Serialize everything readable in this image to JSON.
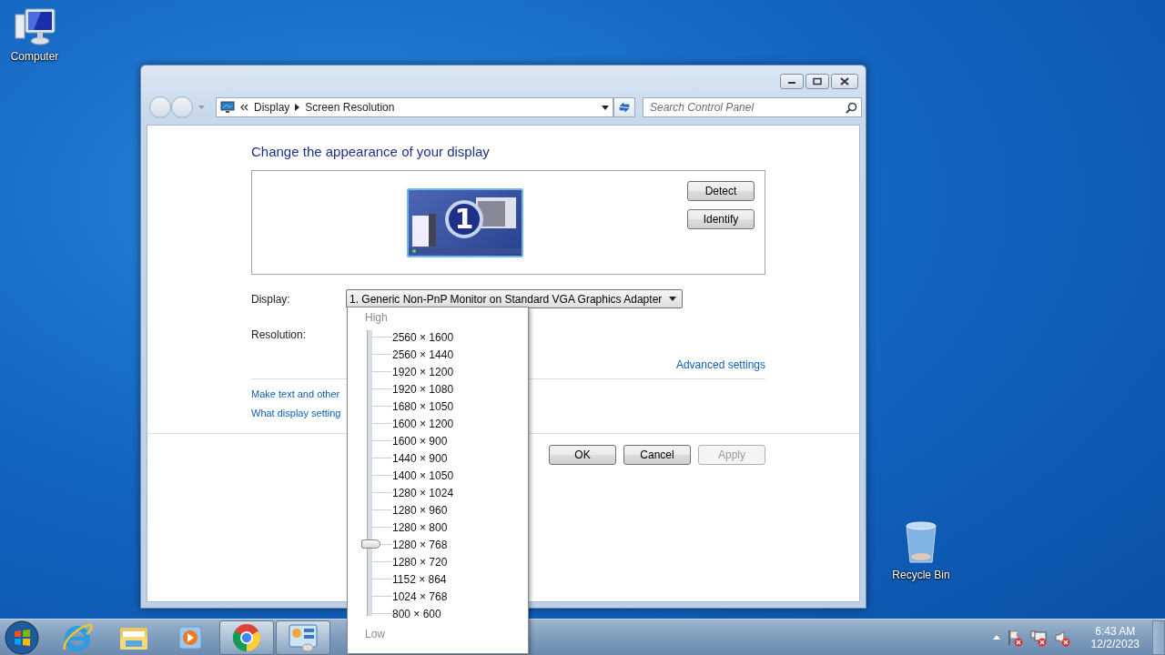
{
  "desktop_icons": [
    {
      "kind": "computer",
      "label": "Computer"
    },
    {
      "kind": "bin",
      "label": "Recycle Bin"
    }
  ],
  "window": {
    "breadcrumbs": [
      "Display",
      "Screen Resolution"
    ],
    "search": {
      "placeholder": "Search Control Panel"
    },
    "heading": "Change the appearance of your display",
    "monitor_number": "1",
    "side_buttons": [
      "Detect",
      "Identify"
    ],
    "display": {
      "label": "Display:",
      "value": "1. Generic Non-PnP Monitor on Standard VGA Graphics Adapter"
    },
    "resolution": {
      "label": "Resolution:"
    },
    "advanced_link": "Advanced settings",
    "links": [
      "Make text and other",
      "What display setting"
    ],
    "buttons": [
      {
        "label": "OK",
        "disabled": false
      },
      {
        "label": "Cancel",
        "disabled": false
      },
      {
        "label": "Apply",
        "disabled": true
      }
    ]
  },
  "resolution_popup": {
    "high_label": "High",
    "low_label": "Low",
    "level": 0.25,
    "options": [
      "2560 × 1600",
      "2560 × 1440",
      "1920 × 1200",
      "1920 × 1080",
      "1680 × 1050",
      "1600 × 1200",
      "1600 × 900",
      "1440 × 900",
      "1400 × 1050",
      "1280 × 1024",
      "1280 × 960",
      "1280 × 800",
      "1280 × 768",
      "1280 × 720",
      "1152 × 864",
      "1024 × 768",
      "800 × 600"
    ]
  },
  "taskbar": {
    "apps": [
      {
        "kind": "ie",
        "running": false
      },
      {
        "kind": "folder",
        "running": false
      },
      {
        "kind": "player",
        "running": false
      },
      {
        "kind": "chrome",
        "running": true
      },
      {
        "kind": "panel",
        "running": true
      }
    ],
    "tray_icons": [
      {
        "kind": "flag",
        "error": true
      },
      {
        "kind": "network",
        "error": true
      },
      {
        "kind": "speaker",
        "error": true
      }
    ],
    "time": "6:43 AM",
    "date": "12/2/2023"
  }
}
